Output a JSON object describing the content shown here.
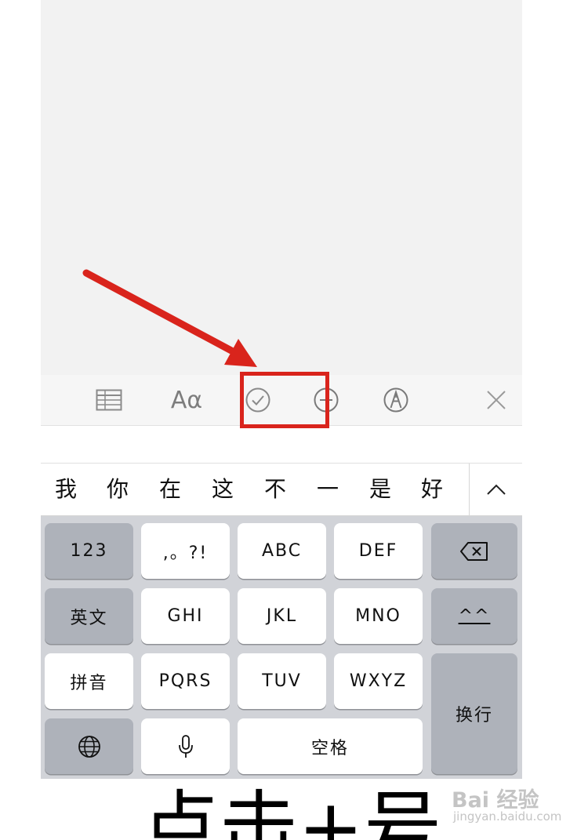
{
  "toolbar": {
    "items": [
      {
        "name": "table-icon"
      },
      {
        "name": "text-format-icon",
        "label": "Aα"
      },
      {
        "name": "checklist-icon"
      },
      {
        "name": "plus-circle-icon"
      },
      {
        "name": "markup-pen-icon"
      },
      {
        "name": "close-icon"
      }
    ],
    "highlight_color": "#d9241c",
    "arrow_color": "#d9241c"
  },
  "candidates": {
    "words": [
      "我",
      "你",
      "在",
      "这",
      "不",
      "一",
      "是",
      "好"
    ],
    "expand_icon": "chevron-up-icon"
  },
  "keyboard": {
    "row1": {
      "left": "123",
      "keys": [
        ",。?!",
        "ABC",
        "DEF"
      ],
      "right_icon": "backspace-icon"
    },
    "row2": {
      "left": "英文",
      "keys": [
        "GHI",
        "JKL",
        "MNO"
      ],
      "right": "^^"
    },
    "row3": {
      "left": "拼音",
      "keys": [
        "PQRS",
        "TUV",
        "WXYZ"
      ]
    },
    "row4": {
      "left_icon": "globe-icon",
      "mic_icon": "microphone-icon",
      "space": "空格"
    },
    "return": "换行"
  },
  "caption": "点击+号",
  "watermark": {
    "brand": "Bai 经验",
    "sub": "jingyan.baidu.com"
  }
}
